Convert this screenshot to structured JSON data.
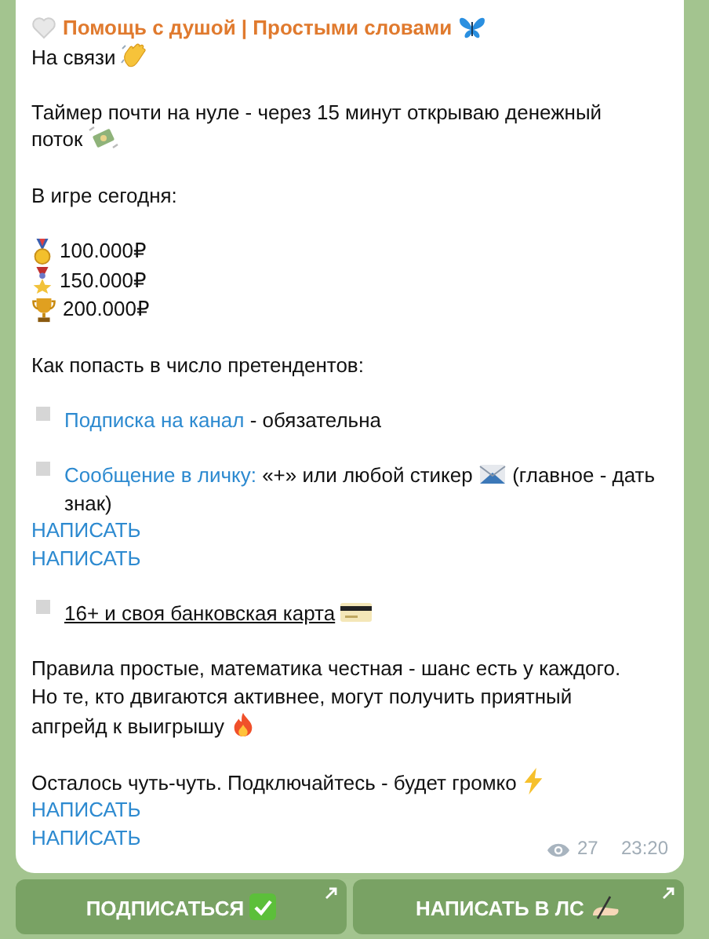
{
  "channel": {
    "title": "Помощь с душой | Простыми словами"
  },
  "message": {
    "blocks": [
      {
        "kind": "text",
        "text": "На связи"
      },
      {
        "kind": "text",
        "text": "Таймер почти на нуле - через 15 минут открываю денежный\nпоток"
      },
      {
        "kind": "text",
        "text": "В игре сегодня:"
      },
      {
        "kind": "prizes",
        "items": [
          "100.000₽",
          "150.000₽",
          "200.000₽"
        ]
      },
      {
        "kind": "text",
        "text": "Как попасть в число претендентов:"
      },
      {
        "kind": "link_bullet",
        "link": "Подписка на канал",
        "text": " - обязательна"
      },
      {
        "kind": "link_bullet",
        "link": "Сообщение в личку:",
        "text": " «+» или любой стикер",
        "text_after": "(главное - дать\nзнак)",
        "buttons": [
          "НАПИСАТЬ",
          "НАПИСАТЬ"
        ]
      },
      {
        "kind": "underlined_bullet",
        "link": "16+ и своя банковская карта"
      },
      {
        "kind": "text",
        "text": "Правила простые, математика честная - шанс есть у каждого.\nНо те, кто двигаются активнее, могут получить приятный\nапгрейд к выигрышу"
      },
      {
        "kind": "text",
        "text": "Осталось чуть-чуть. Подключайтесь - будет громко",
        "buttons": [
          "НАПИСАТЬ",
          "НАПИСАТЬ"
        ]
      }
    ],
    "views": "27",
    "time": "23:20"
  },
  "buttons": [
    {
      "label": "ПОДПИСАТЬСЯ"
    },
    {
      "label": "НАПИСАТЬ В ЛС"
    }
  ]
}
